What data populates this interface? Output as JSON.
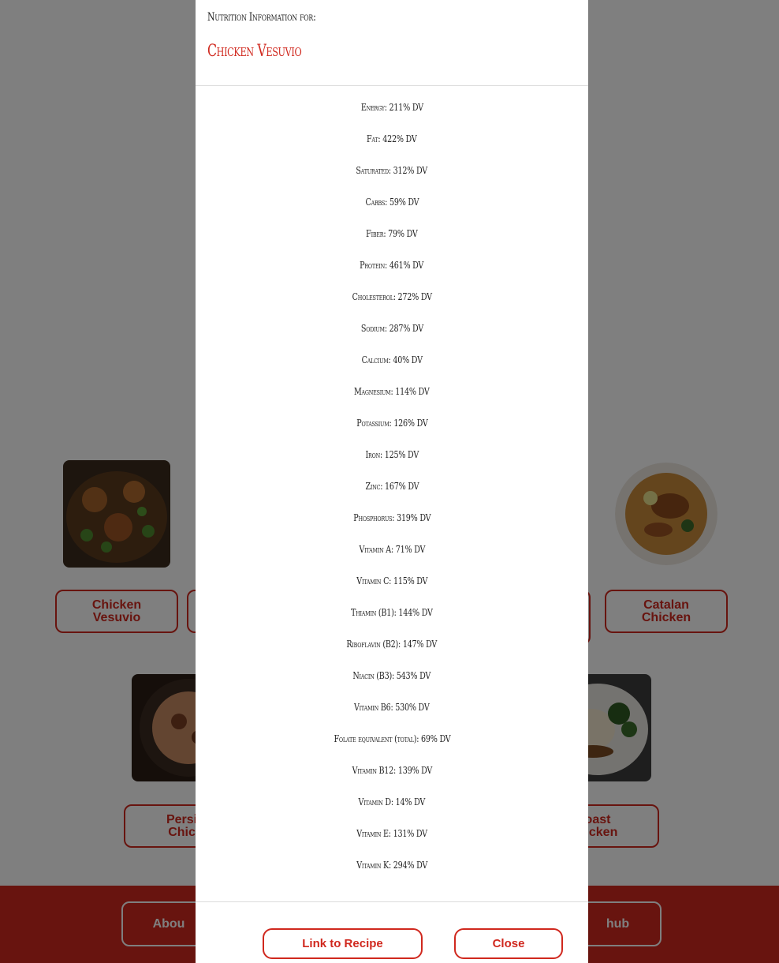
{
  "modal": {
    "kicker": "Nutrition Information for:",
    "title": "Chicken Vesuvio",
    "nutrients": [
      "Energy: 211% DV",
      "Fat: 422% DV",
      "Saturated: 312% DV",
      "Carbs: 59% DV",
      "Fiber: 79% DV",
      "Protein: 461% DV",
      "Cholesterol: 272% DV",
      "Sodium: 287% DV",
      "Calcium: 40% DV",
      "Magnesium: 114% DV",
      "Potassium: 126% DV",
      "Iron: 125% DV",
      "Zinc: 167% DV",
      "Phosphorus: 319% DV",
      "Vitamin A: 71% DV",
      "Vitamin C: 115% DV",
      "Thiamin (B1): 144% DV",
      "Riboflavin (B2): 147% DV",
      "Niacin (B3): 543% DV",
      "Vitamin B6: 530% DV",
      "Folate equivalent (total): 69% DV",
      "Vitamin B12: 139% DV",
      "Vitamin D: 14% DV",
      "Vitamin E: 131% DV",
      "Vitamin K: 294% DV"
    ],
    "link_label": "Link to Recipe",
    "close_label": "Close"
  },
  "background": {
    "cards": [
      {
        "line1": "Chicken",
        "line2": "Vesuvio"
      },
      {
        "line1": "Catalan",
        "line2": "Chicken"
      },
      {
        "line1": "Persia",
        "line2": "Chick"
      },
      {
        "line1": "oast",
        "line2": "hicken"
      }
    ],
    "footer": {
      "left_label": "Abou",
      "right_label": "hub"
    }
  }
}
